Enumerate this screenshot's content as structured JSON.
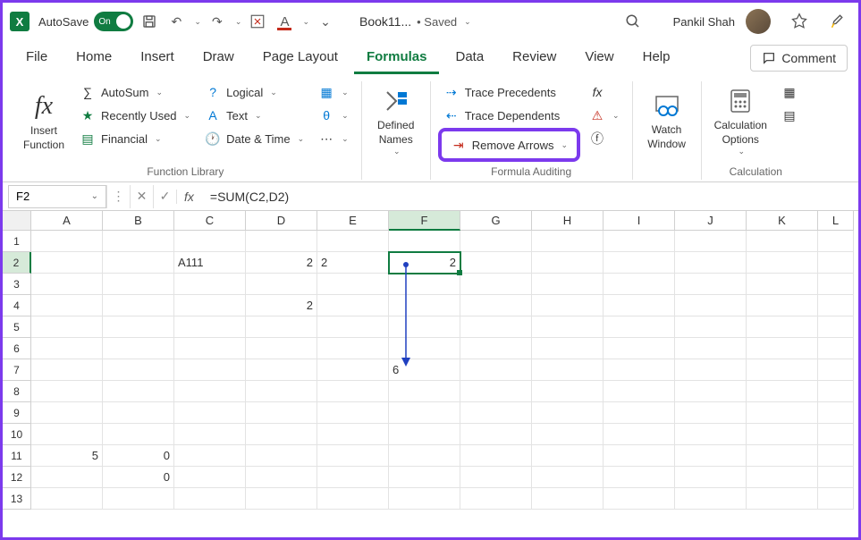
{
  "titlebar": {
    "autosave_label": "AutoSave",
    "autosave_on": "On",
    "doc_title": "Book11...",
    "saved_status": "• Saved",
    "user_name": "Pankil Shah"
  },
  "tabs": {
    "items": [
      "File",
      "Home",
      "Insert",
      "Draw",
      "Page Layout",
      "Formulas",
      "Data",
      "Review",
      "View",
      "Help"
    ],
    "active": "Formulas",
    "comment_label": "Comment"
  },
  "ribbon": {
    "insert_function": "Insert\nFunction",
    "autosum": "AutoSum",
    "recently_used": "Recently Used",
    "financial": "Financial",
    "logical": "Logical",
    "text": "Text",
    "date_time": "Date & Time",
    "function_library_label": "Function Library",
    "defined_names": "Defined\nNames",
    "trace_precedents": "Trace Precedents",
    "trace_dependents": "Trace Dependents",
    "remove_arrows": "Remove Arrows",
    "formula_auditing_label": "Formula Auditing",
    "watch_window": "Watch\nWindow",
    "calculation_options": "Calculation\nOptions",
    "calculation_label": "Calculation"
  },
  "formula_bar": {
    "cell_ref": "F2",
    "formula": "=SUM(C2,D2)"
  },
  "grid": {
    "columns": [
      "A",
      "B",
      "C",
      "D",
      "E",
      "F",
      "G",
      "H",
      "I",
      "J",
      "K",
      "L"
    ],
    "rows": 13,
    "selected_col": "F",
    "selected_row": 2,
    "cells": {
      "C2": "A111",
      "D2": "2",
      "E2": "2",
      "F2": "2",
      "D4": "2",
      "F7": "6",
      "A11": "5",
      "B11": "0",
      "B12": "0"
    }
  },
  "chart_data": null
}
